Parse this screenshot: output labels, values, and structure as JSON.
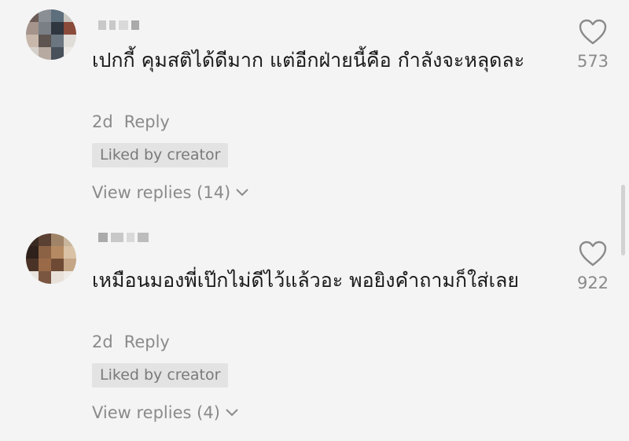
{
  "comments": [
    {
      "text": "เปกกี้ คุมสติได้ดีมาก แต่อีกฝ่ายนี้คือ กำลังจะหลุดละ",
      "time": "2d",
      "reply_label": "Reply",
      "badge": "Liked by creator",
      "view_replies": "View replies (14)",
      "likes": "573"
    },
    {
      "text": "เหมือนมองพี่เป๊กไม่ดีไว้แล้วอะ พอยิงคำถามก็ใส่เลย",
      "time": "2d",
      "reply_label": "Reply",
      "badge": "Liked by creator",
      "view_replies": "View replies (4)",
      "likes": "922"
    }
  ],
  "colors": {
    "background": "#f4f4f4",
    "text": "#1a1a1a",
    "muted": "#8a8a8a",
    "badge_bg": "#e3e3e3"
  },
  "icons": {
    "like": "heart-outline-icon",
    "expand": "chevron-down-icon"
  }
}
